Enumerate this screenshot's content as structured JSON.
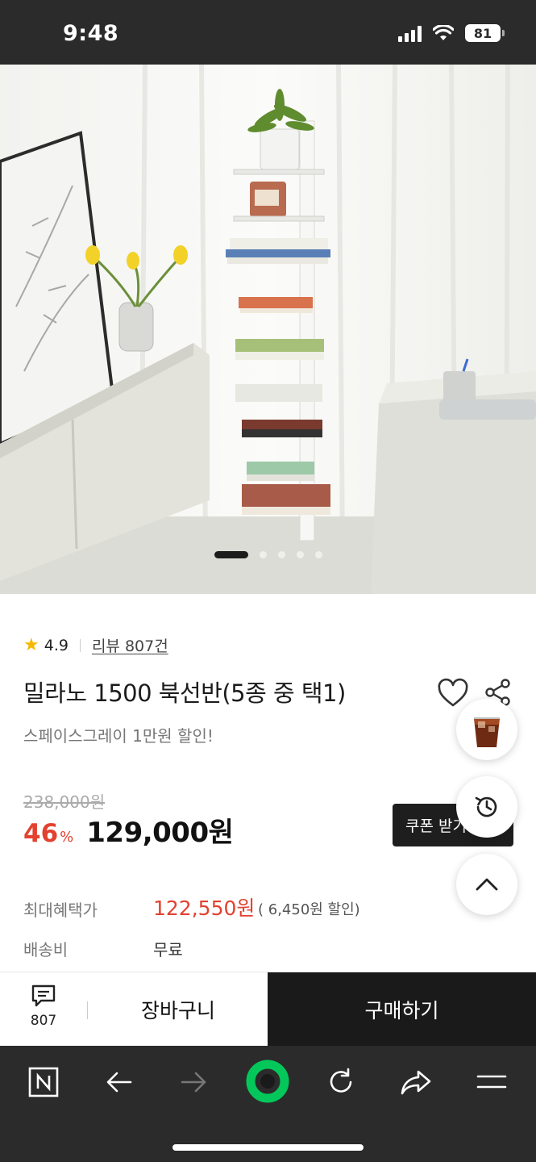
{
  "status_bar": {
    "time": "9:48",
    "battery": "81"
  },
  "carousel": {
    "total": 5,
    "active": 0
  },
  "rating": {
    "score": "4.9",
    "reviews_label": "리뷰 807건"
  },
  "product": {
    "title": "밀라노 1500 북선반(5종 중 택1)",
    "subtitle": "스페이스그레이 1만원 할인!",
    "original_price": "238,000원",
    "discount": "46",
    "discount_unit": "%",
    "price": "129,000원"
  },
  "coupon": {
    "label": "쿠폰 받기"
  },
  "benefit": {
    "label": "최대혜택가",
    "value": "122,550원",
    "note": "( 6,450원 할인)"
  },
  "shipping": {
    "label": "배송비",
    "value": "무료"
  },
  "action_bar": {
    "review_count": "807",
    "cart_label": "장바구니",
    "buy_label": "구매하기"
  },
  "colors": {
    "accent_red": "#e2412f",
    "naver_green": "#03c75a",
    "dark": "#1a1a1a"
  },
  "icons": [
    "heart-icon",
    "share-icon",
    "history-icon",
    "arrow-up-icon",
    "review-chat-icon",
    "naver-n-icon",
    "back-icon",
    "forward-icon",
    "green-dot-icon",
    "refresh-icon",
    "share-arrow-icon",
    "menu-icon"
  ]
}
